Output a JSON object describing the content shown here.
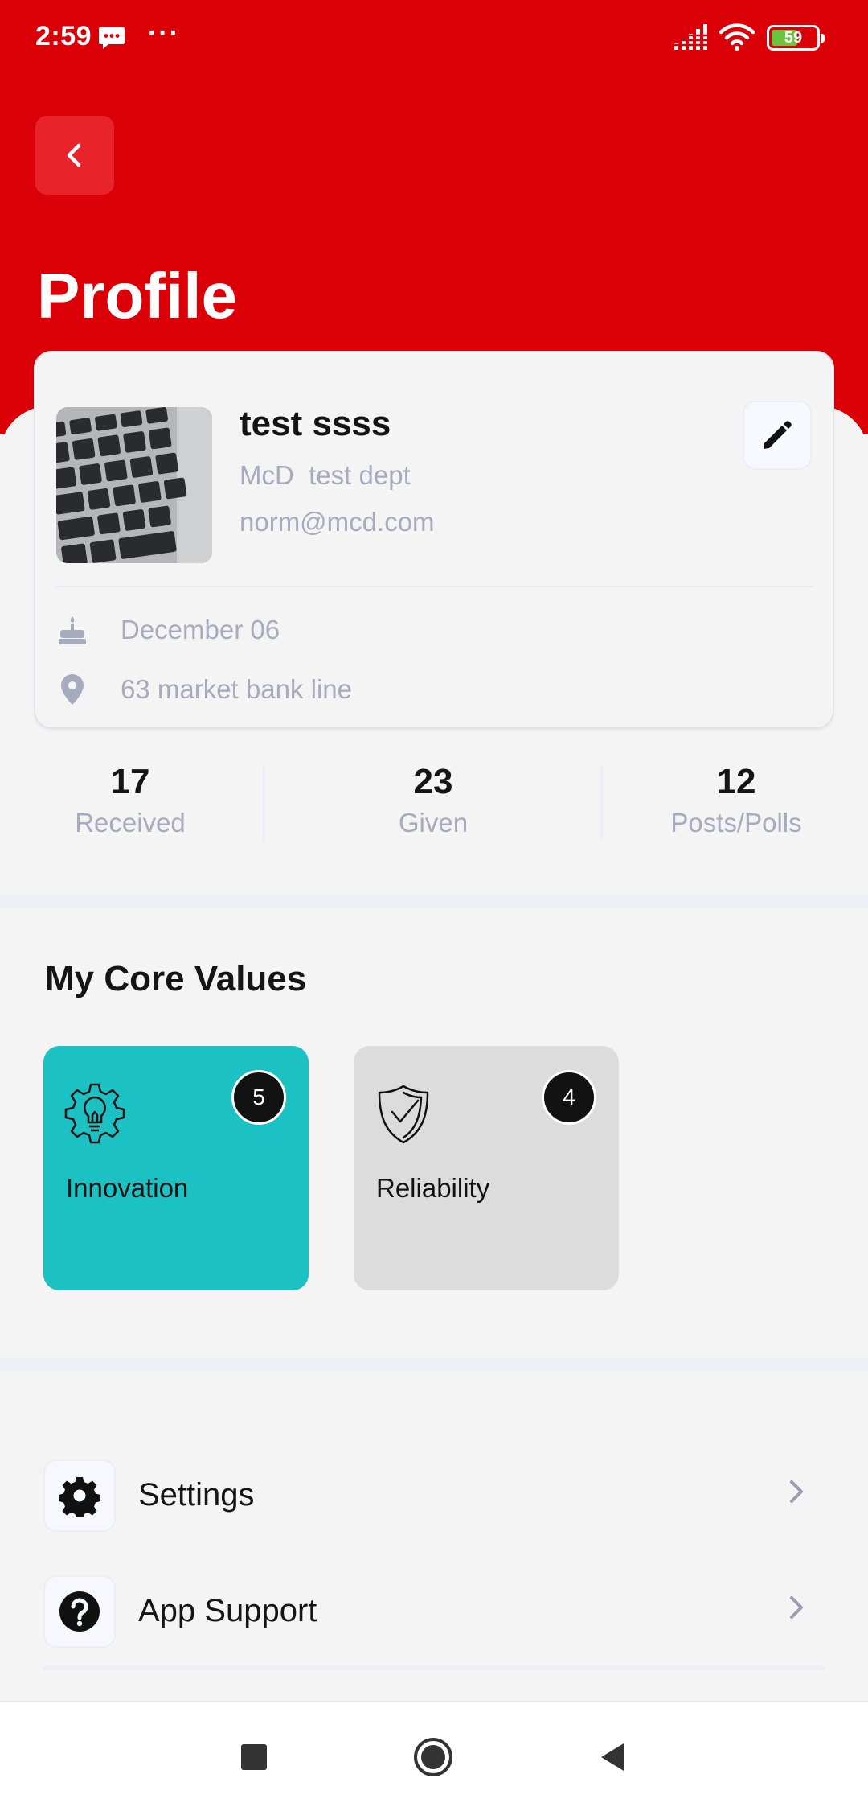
{
  "status_bar": {
    "time": "2:59",
    "dots": "···",
    "battery_level": "59",
    "battery_fraction": 0.59
  },
  "header": {
    "title": "Profile",
    "background_color": "#db0007"
  },
  "profile": {
    "name": "test ssss",
    "org": "McD  test dept",
    "email": "norm@mcd.com",
    "birthday": "December 06",
    "address": "63 market bank line"
  },
  "stats": [
    {
      "value": "17",
      "label": "Received"
    },
    {
      "value": "23",
      "label": "Given"
    },
    {
      "value": "12",
      "label": "Posts/Polls"
    }
  ],
  "core_values": {
    "title": "My Core Values",
    "items": [
      {
        "label": "Innovation",
        "count": "5",
        "icon": "lightbulb-gear-icon",
        "color": "#1bc1c3"
      },
      {
        "label": "Reliability",
        "count": "4",
        "icon": "shield-check-icon",
        "color": "#dcdcdc"
      }
    ]
  },
  "menu": [
    {
      "label": "Settings",
      "icon": "gear-icon"
    },
    {
      "label": "App Support",
      "icon": "help-icon"
    }
  ],
  "nav_bar": {
    "icons": [
      "recents-square-icon",
      "home-circle-icon",
      "back-triangle-icon"
    ]
  }
}
